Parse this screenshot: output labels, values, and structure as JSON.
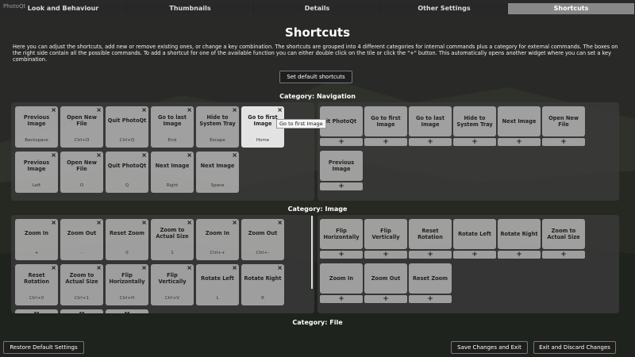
{
  "window": {
    "corner_text": "PhotoQt"
  },
  "tabs": [
    {
      "label": "Look and Behaviour"
    },
    {
      "label": "Thumbnails"
    },
    {
      "label": "Details"
    },
    {
      "label": "Other Settings"
    },
    {
      "label": "Shortcuts",
      "active": true
    }
  ],
  "title": "Shortcuts",
  "intro": "Here you can adjust the shortcuts, add new or remove existing ones, or change a key combination. The shortcuts are grouped into 4 different categories for internal commands plus a category for external commands. The boxes on the right side contain all the possible commands. To add a shortcut for one of the available function you can either double click on the tile or click the \"+\" button. This automatically opens another widget where you can set a key combination.",
  "set_default_label": "Set default shortcuts",
  "tooltip": "Go to first Image",
  "categories": [
    {
      "label": "Category: Navigation",
      "assigned": [
        {
          "name": "Previous Image",
          "key": "Backspace",
          "close": "×"
        },
        {
          "name": "Open New File",
          "key": "Ctrl+O",
          "close": "×"
        },
        {
          "name": "Quit PhotoQt",
          "key": "Ctrl+Q",
          "close": "×"
        },
        {
          "name": "Go to last Image",
          "key": "End",
          "close": "×"
        },
        {
          "name": "Hide to System Tray",
          "key": "Escape",
          "close": "×"
        },
        {
          "name": "Go to first Image",
          "key": "Home",
          "close": "×",
          "highlighted": true
        },
        {
          "name": "Previous Image",
          "key": "Left",
          "close": "×"
        },
        {
          "name": "Open New File",
          "key": "O",
          "close": "×"
        },
        {
          "name": "Quit PhotoQt",
          "key": "Q",
          "close": "×"
        },
        {
          "name": "Next Image",
          "key": "Right",
          "close": "×"
        },
        {
          "name": "Next Image",
          "key": "Space",
          "close": "×"
        }
      ],
      "available": [
        {
          "name": "it PhotoQt",
          "plus": "+"
        },
        {
          "name": "Go to first Image",
          "plus": "+"
        },
        {
          "name": "Go to last Image",
          "plus": "+"
        },
        {
          "name": "Hide to System Tray",
          "plus": "+"
        },
        {
          "name": "Next Image",
          "plus": "+"
        },
        {
          "name": "Open New File",
          "plus": "+"
        },
        {
          "name": "Previous Image",
          "plus": "+"
        }
      ]
    },
    {
      "label": "Category: Image",
      "assigned": [
        {
          "name": "Zoom In",
          "key": "+",
          "close": "×"
        },
        {
          "name": "Zoom Out",
          "key": "-",
          "close": "×"
        },
        {
          "name": "Reset Zoom",
          "key": "0",
          "close": "×"
        },
        {
          "name": "Zoom to Actual Size",
          "key": "1",
          "close": "×"
        },
        {
          "name": "Zoom In",
          "key": "Ctrl++",
          "close": "×"
        },
        {
          "name": "Zoom Out",
          "key": "Ctrl+-",
          "close": "×"
        },
        {
          "name": "Reset Rotation",
          "key": "Ctrl+0",
          "close": "×"
        },
        {
          "name": "Zoom to Actual Size",
          "key": "Ctrl+1",
          "close": "×"
        },
        {
          "name": "Flip Horizontally",
          "key": "Ctrl+H",
          "close": "×"
        },
        {
          "name": "Flip Vertically",
          "key": "Ctrl+V",
          "close": "×"
        },
        {
          "name": "Rotate Left",
          "key": "L",
          "close": "×"
        },
        {
          "name": "Rotate Right",
          "key": "R",
          "close": "×"
        }
      ],
      "partial_row": [
        "M",
        "M",
        "M"
      ],
      "available": [
        {
          "name": "Flip Horizontally",
          "plus": "+"
        },
        {
          "name": "Flip Vertically",
          "plus": "+"
        },
        {
          "name": "Reset Rotation",
          "plus": "+"
        },
        {
          "name": "Rotate Left",
          "plus": "+"
        },
        {
          "name": "Rotate Right",
          "plus": "+"
        },
        {
          "name": "Zoom to Actual Size",
          "plus": "+"
        },
        {
          "name": "Zoom In",
          "plus": "+"
        },
        {
          "name": "Zoom Out",
          "plus": "+"
        },
        {
          "name": "Reset Zoom",
          "plus": "+"
        }
      ]
    },
    {
      "label": "Category: File"
    }
  ],
  "footer": {
    "restore_label": "Restore Default Settings",
    "save_label": "Save Changes and Exit",
    "exit_label": "Exit and Discard Changes"
  }
}
